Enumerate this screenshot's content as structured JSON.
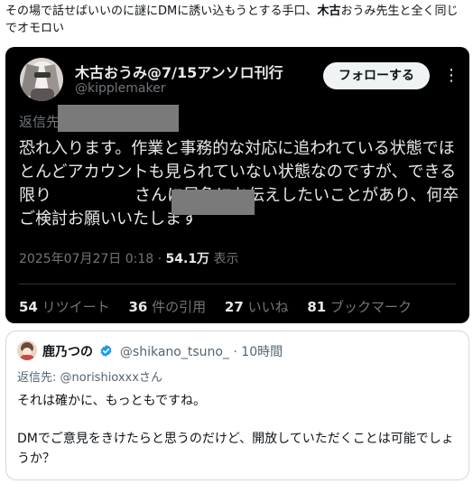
{
  "caption": {
    "part1": "その場で話せばいいのに謎にDMに誘い込もうとする手口、",
    "bold": "木古",
    "part2": "おうみ先生と全く同じでオモロい"
  },
  "quoted_tweet": {
    "display_name": "木古おうみ@7/15アンソロ刊行",
    "handle": "@kipplemaker",
    "follow_label": "フォローする",
    "more_label": "⋮",
    "reply_label": "返信先",
    "body_part1": "恐れ入ります。作業と事務的な対応に追われている状態でほとんどアカウントも見られていない状態なのですが、できる限り",
    "body_part2": "さんに早急にお伝えしたいことがあり、何卒ご検討お願いいたします",
    "timestamp": "2025年07月27日 0:18",
    "separator": "·",
    "views_count": "54.1万",
    "views_label": "表示",
    "stats": {
      "retweets_count": "54",
      "retweets_label": "リツイート",
      "quotes_count": "36",
      "quotes_label": "件の引用",
      "likes_count": "27",
      "likes_label": "いいね",
      "bookmarks_count": "81",
      "bookmarks_label": "ブックマーク"
    }
  },
  "reply_tweet": {
    "display_name": "鹿乃つの",
    "handle": "@shikano_tsuno_",
    "separator": "·",
    "time": "10時間",
    "reply_to_label": "返信先:",
    "reply_to_mention": "@norishioxxxさん",
    "body_line1": "それは確かに、もっともですね。",
    "body_line2": "DMでご意見をきけたらと思うのだけど、開放していただくことは可能でしょうか？"
  },
  "colors": {
    "dark_bg": "#000000",
    "dark_text": "#e7e9ea",
    "dark_muted": "#71767b",
    "verified_blue": "#1d9bf0",
    "redaction_gray": "#7a7a7a"
  }
}
